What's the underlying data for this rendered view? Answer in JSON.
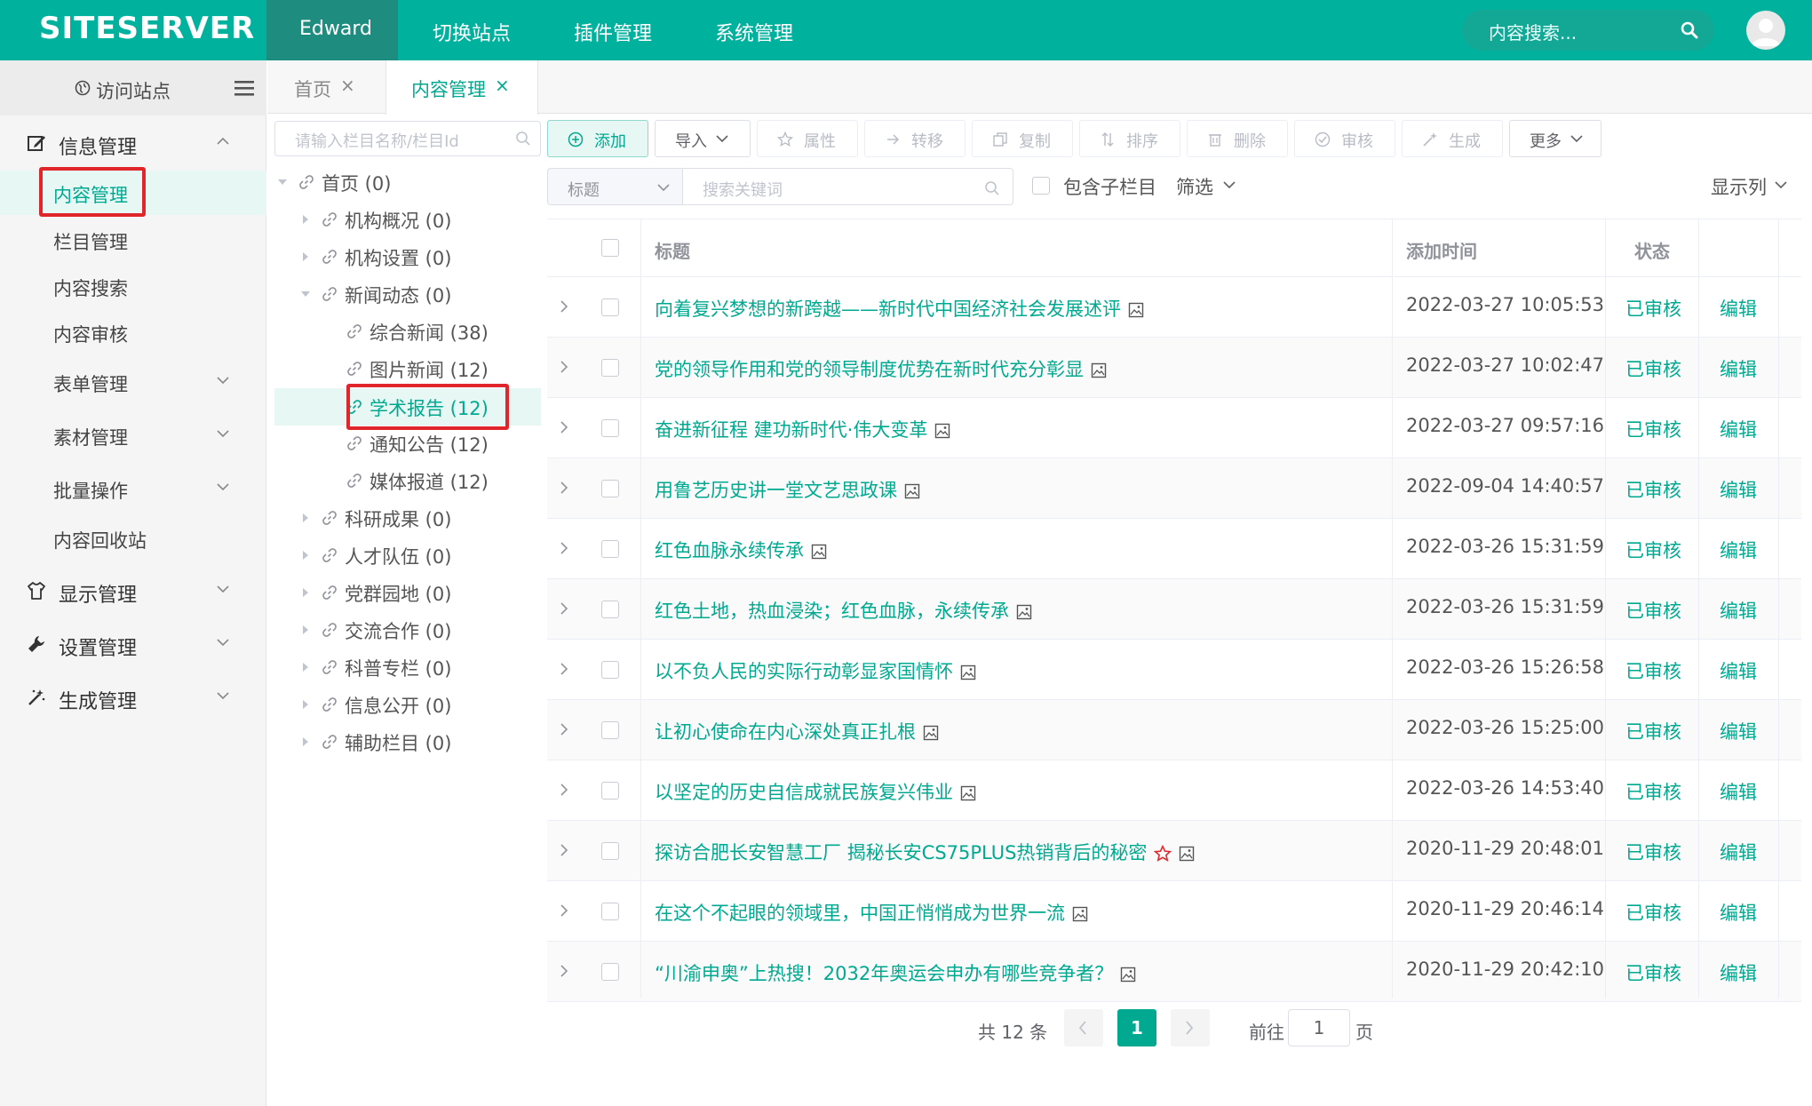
{
  "topbar": {
    "logo": "SITESERVER",
    "nav": [
      "Edward",
      "切换站点",
      "插件管理",
      "系统管理"
    ],
    "search_placeholder": "内容搜索..."
  },
  "sidebar": {
    "visit_label": "访问站点",
    "groups": [
      {
        "label": "信息管理",
        "icon": "edit-icon"
      },
      {
        "label": "显示管理",
        "icon": "tshirt-icon"
      },
      {
        "label": "设置管理",
        "icon": "wrench-icon"
      },
      {
        "label": "生成管理",
        "icon": "magic-icon"
      }
    ],
    "subitems": [
      "内容管理",
      "栏目管理",
      "内容搜索",
      "内容审核",
      "表单管理",
      "素材管理",
      "批量操作",
      "内容回收站"
    ]
  },
  "tabs": [
    {
      "label": "首页",
      "active": false
    },
    {
      "label": "内容管理",
      "active": true
    }
  ],
  "tree": {
    "search_placeholder": "请输入栏目名称/栏目Id",
    "nodes": [
      "首页 (0)",
      "机构概况 (0)",
      "机构设置 (0)",
      "新闻动态 (0)",
      "综合新闻 (38)",
      "图片新闻 (12)",
      "学术报告 (12)",
      "通知公告 (12)",
      "媒体报道 (12)",
      "科研成果 (0)",
      "人才队伍 (0)",
      "党群园地 (0)",
      "交流合作 (0)",
      "科普专栏 (0)",
      "信息公开 (0)",
      "辅助栏目 (0)"
    ]
  },
  "toolbar": {
    "add": "添加",
    "import": "导入",
    "attr": "属性",
    "transfer": "转移",
    "copy": "复制",
    "sort": "排序",
    "delete": "删除",
    "review": "审核",
    "generate": "生成",
    "more": "更多"
  },
  "filter": {
    "field_value": "标题",
    "keyword_placeholder": "搜索关键词",
    "include_sub": "包含子栏目",
    "filter_label": "筛选",
    "columns_label": "显示列"
  },
  "table": {
    "headers": {
      "title": "标题",
      "time": "添加时间",
      "status": "状态"
    },
    "rows": [
      {
        "title": "向着复兴梦想的新跨越——新时代中国经济社会发展述评",
        "time": "2022-03-27 10:05:53",
        "status": "已审核",
        "edit": "编辑"
      },
      {
        "title": "党的领导作用和党的领导制度优势在新时代充分彰显",
        "time": "2022-03-27 10:02:47",
        "status": "已审核",
        "edit": "编辑"
      },
      {
        "title": "奋进新征程 建功新时代·伟大变革",
        "time": "2022-03-27 09:57:16",
        "status": "已审核",
        "edit": "编辑"
      },
      {
        "title": "用鲁艺历史讲一堂文艺思政课",
        "time": "2022-09-04 14:40:57",
        "status": "已审核",
        "edit": "编辑"
      },
      {
        "title": "红色血脉永续传承",
        "time": "2022-03-26 15:31:59",
        "status": "已审核",
        "edit": "编辑"
      },
      {
        "title": "红色土地，热血浸染；红色血脉，永续传承",
        "time": "2022-03-26 15:31:59",
        "status": "已审核",
        "edit": "编辑"
      },
      {
        "title": "以不负人民的实际行动彰显家国情怀",
        "time": "2022-03-26 15:26:58",
        "status": "已审核",
        "edit": "编辑"
      },
      {
        "title": "让初心使命在内心深处真正扎根",
        "time": "2022-03-26 15:25:00",
        "status": "已审核",
        "edit": "编辑"
      },
      {
        "title": "以坚定的历史自信成就民族复兴伟业",
        "time": "2022-03-26 14:53:40",
        "status": "已审核",
        "edit": "编辑"
      },
      {
        "title": "探访合肥长安智慧工厂 揭秘长安CS75PLUS热销背后的秘密",
        "time": "2020-11-29 20:48:01",
        "status": "已审核",
        "edit": "编辑",
        "starred": true
      },
      {
        "title": "在这个不起眼的领域里，中国正悄悄成为世界一流",
        "time": "2020-11-29 20:46:14",
        "status": "已审核",
        "edit": "编辑"
      },
      {
        "title": "“川渝申奥”上热搜！2032年奥运会申办有哪些竞争者？",
        "time": "2020-11-29 20:42:10",
        "status": "已审核",
        "edit": "编辑"
      }
    ]
  },
  "pagination": {
    "total": "共 12 条",
    "current": "1",
    "goto_label": "前往",
    "goto_value": "1",
    "page_suffix": "页"
  },
  "colors": {
    "brand": "#00b19d",
    "accent": "#00a98f",
    "highlight": "#e0252b"
  }
}
